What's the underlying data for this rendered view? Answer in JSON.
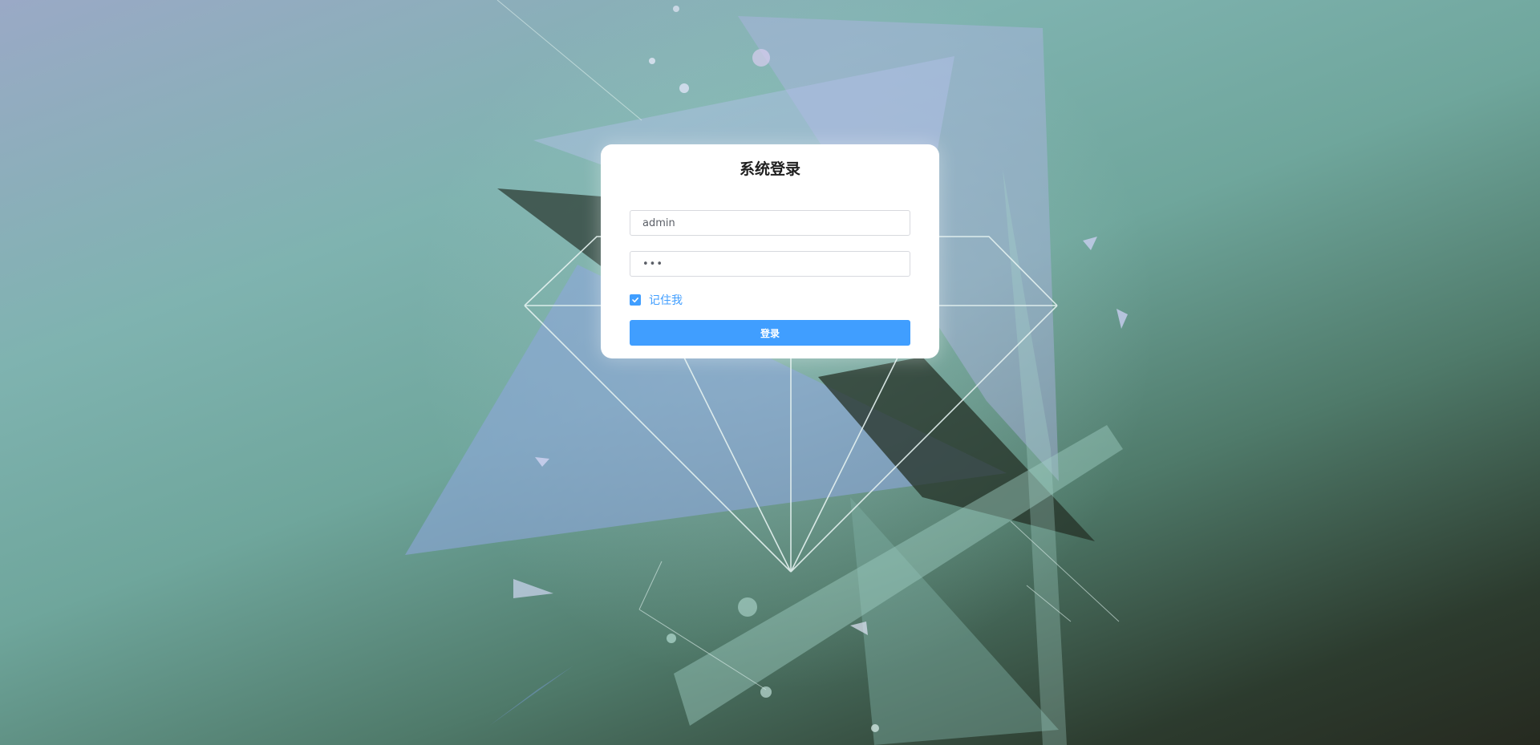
{
  "login": {
    "title": "系统登录",
    "username_value": "admin",
    "password_value": "•••",
    "remember_label": "记住我",
    "remember_checked": true,
    "submit_label": "登录"
  },
  "icons": {
    "checkbox": "check-icon"
  },
  "colors": {
    "accent": "#409eff",
    "card_background": "#ffffff",
    "title_text": "#1f1f1f"
  }
}
